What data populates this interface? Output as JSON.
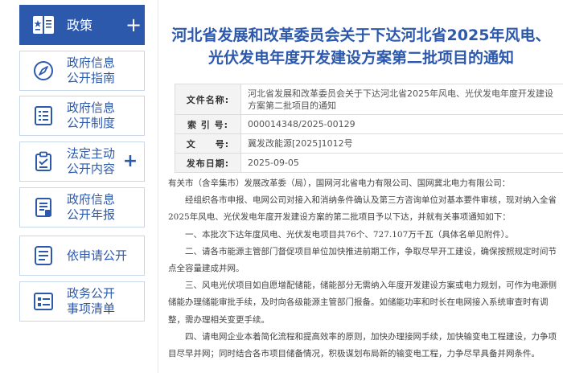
{
  "sidebar": {
    "items": [
      {
        "label": "政策",
        "icon": "policy-book-icon",
        "has_plus": true,
        "active": true
      },
      {
        "label": "政府信息公开指南",
        "icon": "compass-icon",
        "has_plus": false,
        "active": false
      },
      {
        "label": "政府信息公开制度",
        "icon": "list-document-icon",
        "has_plus": false,
        "active": false
      },
      {
        "label": "法定主动公开内容",
        "icon": "checklist-icon",
        "has_plus": true,
        "active": false
      },
      {
        "label": "政府信息公开年报",
        "icon": "annual-report-icon",
        "has_plus": false,
        "active": false
      },
      {
        "label": "依申请公开",
        "icon": "application-form-icon",
        "has_plus": false,
        "active": false
      },
      {
        "label": "政务公开事项清单",
        "icon": "item-list-icon",
        "has_plus": false,
        "active": false
      }
    ],
    "plus_symbol": "+"
  },
  "article": {
    "title": "河北省发展和改革委员会关于下达河北省2025年风电、光伏发电年度开发建设方案第二批项目的通知",
    "meta": [
      {
        "key": "文件名称:",
        "value": "河北省发展和改革委员会关于下达河北省2025年风电、光伏发电年度开发建设方案第二批项目的通知"
      },
      {
        "key": "索 引 号:",
        "value": "000014348/2025-00129"
      },
      {
        "key": "文　　号:",
        "value": "冀发改能源[2025]1012号"
      },
      {
        "key": "发布日期:",
        "value": "2025-09-05"
      }
    ],
    "paragraphs": [
      "有关市（含辛集市）发展改革委（局），国网河北省电力有限公司、国网冀北电力有限公司：",
      "经组织各市申报、电网公司对接入和消纳条件确认及第三方咨询单位对基本要件审核，现对纳入全省2025年风电、光伏发电年度开发建设方案的第二批项目予以下达，并就有关事项通知如下：",
      "一、本批次下达年度风电、光伏发电项目共76个、727.107万千瓦（具体名单见附件）。",
      "二、请各市能源主管部门督促项目单位加快推进前期工作，争取尽早开工建设，确保按照规定时间节点全容量建成并网。",
      "三、风电光伏项目如自愿增配储能，储能部分无需纳入年度开发建设方案或电力规划，可作为电源侧储能办理储能审批手续，及时向各级能源主管部门报备。如储能功率和时长在电网接入系统审查时有调整，需办理相关变更手续。",
      "四、请电网企业本着简化流程和提高效率的原则，加快办理接网手续，加快输变电工程建设，力争项目尽早并网；同时结合各市项目储备情况，积极谋划布局新的输变电工程，力争尽早具备并网条件。"
    ]
  },
  "colors": {
    "accent": "#2d59ad",
    "border": "#c9d7ea",
    "label_bg": "#f3f3f3"
  }
}
